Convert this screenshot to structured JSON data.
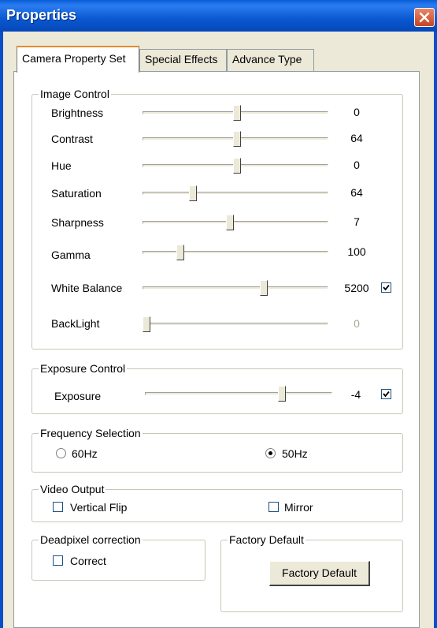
{
  "window": {
    "title": "Properties"
  },
  "tabs": [
    {
      "label": "Camera Property Set",
      "active": true
    },
    {
      "label": "Special Effects",
      "active": false
    },
    {
      "label": "Advance Type",
      "active": false
    }
  ],
  "image_control": {
    "legend": "Image Control",
    "sliders": [
      {
        "label": "Brightness",
        "value": "0",
        "level": 0.51
      },
      {
        "label": "Contrast",
        "value": "64",
        "level": 0.51
      },
      {
        "label": "Hue",
        "value": "0",
        "level": 0.51
      },
      {
        "label": "Saturation",
        "value": "64",
        "level": 0.26
      },
      {
        "label": "Sharpness",
        "value": "7",
        "level": 0.47
      },
      {
        "label": "Gamma",
        "value": "100",
        "level": 0.19
      },
      {
        "label": "White Balance",
        "value": "5200",
        "level": 0.66,
        "auto_checked": true
      },
      {
        "label": "BackLight",
        "value": "0",
        "level": 0.0,
        "disabled": true
      }
    ]
  },
  "exposure_control": {
    "legend": "Exposure Control",
    "slider": {
      "label": "Exposure",
      "value": "-4",
      "level": 0.74,
      "auto_checked": true
    }
  },
  "frequency": {
    "legend": "Frequency Selection",
    "options": [
      {
        "label": "60Hz",
        "selected": false
      },
      {
        "label": "50Hz",
        "selected": true
      }
    ]
  },
  "video_output": {
    "legend": "Video Output",
    "options": [
      {
        "label": "Vertical Flip",
        "checked": false
      },
      {
        "label": "Mirror",
        "checked": false
      }
    ]
  },
  "deadpixel": {
    "legend": "Deadpixel correction",
    "option": {
      "label": "Correct",
      "checked": false
    }
  },
  "factory": {
    "legend": "Factory Default",
    "button_label": "Factory Default"
  }
}
